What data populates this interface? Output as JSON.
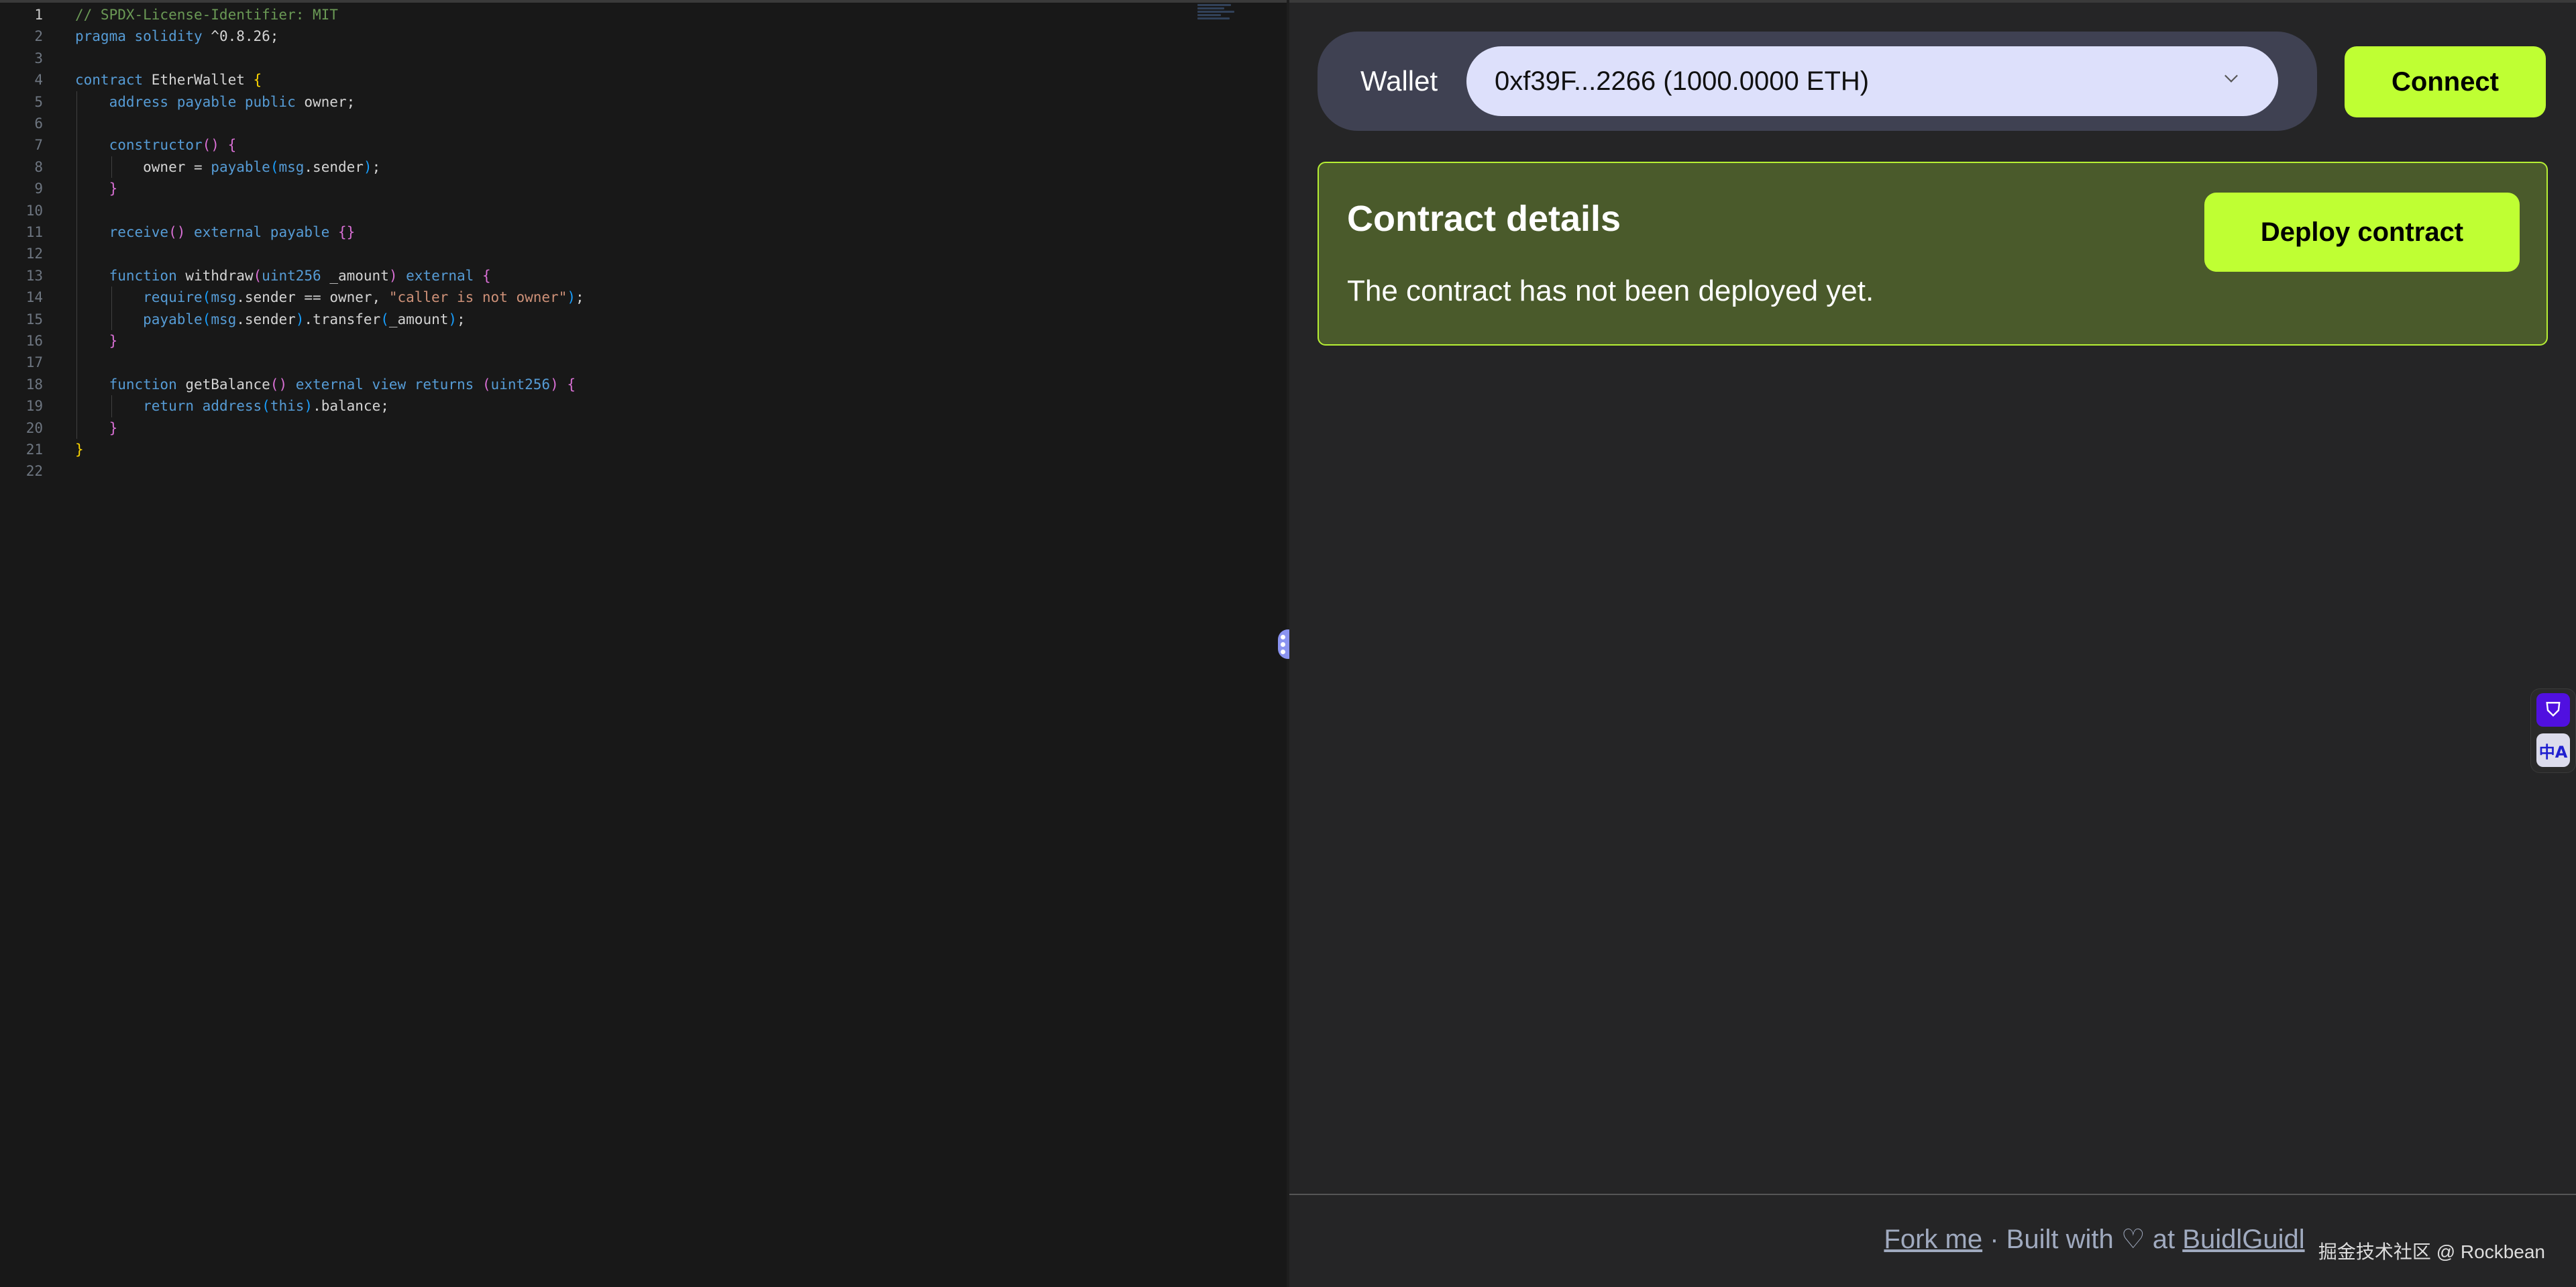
{
  "editor": {
    "lines": [
      [
        [
          "// SPDX-License-Identifier: MIT",
          "c"
        ]
      ],
      [
        [
          "pragma solidity",
          "k"
        ],
        [
          " ^0.8.26;",
          "p"
        ]
      ],
      [],
      [
        [
          "contract",
          "k"
        ],
        [
          " EtherWallet ",
          "p"
        ],
        [
          "{",
          "b1"
        ]
      ],
      [
        [
          "    address payable public",
          "k"
        ],
        [
          " owner;",
          "p"
        ]
      ],
      [],
      [
        [
          "    constructor",
          "k"
        ],
        [
          "()",
          "b2"
        ],
        [
          " ",
          "p"
        ],
        [
          "{",
          "b2"
        ]
      ],
      [
        [
          "        owner = ",
          "p"
        ],
        [
          "payable",
          "k"
        ],
        [
          "(",
          "b3"
        ],
        [
          "msg",
          "k"
        ],
        [
          ".sender",
          "p"
        ],
        [
          ")",
          "b3"
        ],
        [
          ";",
          "p"
        ]
      ],
      [
        [
          "    ",
          "p"
        ],
        [
          "}",
          "b2"
        ]
      ],
      [],
      [
        [
          "    receive",
          "k"
        ],
        [
          "()",
          "b2"
        ],
        [
          " external payable ",
          "k"
        ],
        [
          "{}",
          "b2"
        ]
      ],
      [],
      [
        [
          "    function",
          "k"
        ],
        [
          " withdraw",
          "p"
        ],
        [
          "(",
          "b2"
        ],
        [
          "uint256",
          "k"
        ],
        [
          " _amount",
          "p"
        ],
        [
          ")",
          "b2"
        ],
        [
          " external ",
          "k"
        ],
        [
          "{",
          "b2"
        ]
      ],
      [
        [
          "        require",
          "k"
        ],
        [
          "(",
          "b3"
        ],
        [
          "msg",
          "k"
        ],
        [
          ".sender == owner, ",
          "p"
        ],
        [
          "\"caller is not owner\"",
          "s"
        ],
        [
          ")",
          "b3"
        ],
        [
          ";",
          "p"
        ]
      ],
      [
        [
          "        payable",
          "k"
        ],
        [
          "(",
          "b3"
        ],
        [
          "msg",
          "k"
        ],
        [
          ".sender",
          "p"
        ],
        [
          ")",
          "b3"
        ],
        [
          ".transfer",
          "p"
        ],
        [
          "(",
          "b3"
        ],
        [
          "_amount",
          "p"
        ],
        [
          ")",
          "b3"
        ],
        [
          ";",
          "p"
        ]
      ],
      [
        [
          "    ",
          "p"
        ],
        [
          "}",
          "b2"
        ]
      ],
      [],
      [
        [
          "    function",
          "k"
        ],
        [
          " getBalance",
          "p"
        ],
        [
          "()",
          "b2"
        ],
        [
          " external view returns ",
          "k"
        ],
        [
          "(",
          "b2"
        ],
        [
          "uint256",
          "k"
        ],
        [
          ")",
          "b2"
        ],
        [
          " ",
          "p"
        ],
        [
          "{",
          "b2"
        ]
      ],
      [
        [
          "        return ",
          "k"
        ],
        [
          "address",
          "k"
        ],
        [
          "(",
          "b3"
        ],
        [
          "this",
          "k"
        ],
        [
          ")",
          "b3"
        ],
        [
          ".balance;",
          "p"
        ]
      ],
      [
        [
          "    ",
          "p"
        ],
        [
          "}",
          "b2"
        ]
      ],
      [
        [
          "}",
          "b1"
        ]
      ],
      []
    ],
    "active_line": 1
  },
  "wallet": {
    "label": "Wallet",
    "selected": "0xf39F...2266 (1000.0000 ETH)",
    "connect": "Connect"
  },
  "card": {
    "title": "Contract details",
    "text": "The contract has not been deployed yet.",
    "deploy": "Deploy contract"
  },
  "footer": {
    "fork": "Fork me",
    "middle": " · Built with ♡ at ",
    "buidl": "BuidlGuidl"
  },
  "watermark": "掘金技术社区 @ Rockbean",
  "sidetools": {
    "translate_glyph": "中A"
  },
  "colors": {
    "accent": "#bfff33",
    "card_bg": "#4a5a2b",
    "select_bg": "#dde0fb"
  }
}
